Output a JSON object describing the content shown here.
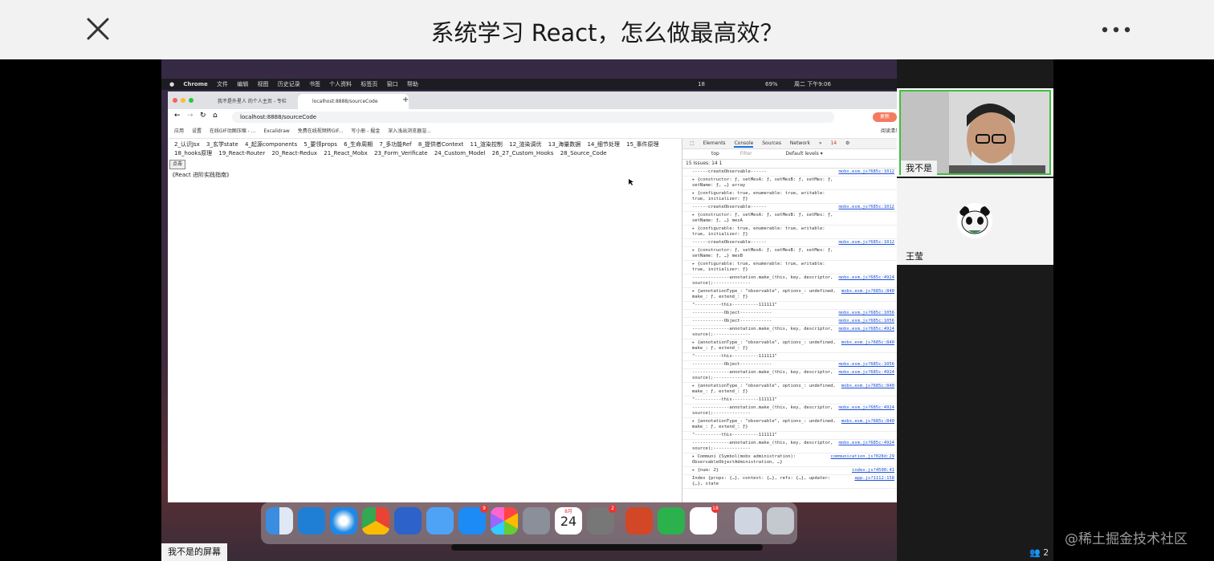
{
  "header": {
    "title": "系统学习 React，怎么做最高效？"
  },
  "mac_menubar": {
    "items": [
      "Chrome",
      "文件",
      "编辑",
      "视图",
      "历史记录",
      "书签",
      "个人资料",
      "标签页",
      "窗口",
      "帮助"
    ],
    "status": "周二 下午9:06",
    "battery": "69%",
    "badge": "18"
  },
  "browser": {
    "tabs": [
      "我不是外星人 的个人主页 - 专栏",
      "localhost:8888/sourceCode"
    ],
    "url": "localhost:8888/sourceCode",
    "update_label": "更新",
    "bookmarks": [
      "应用",
      "设置",
      "在线GIF动图压缩 - ...",
      "Excalidraw",
      "免费在线视频转GIF...",
      "写小册 - 掘金",
      "深入浅出浏览器渲..."
    ],
    "reading_list": "阅读清单"
  },
  "page": {
    "nav_row1": [
      "2_认识Jsx",
      "3_玄学state",
      "4_起源components",
      "5_要领props",
      "6_生命周期",
      "7_多功能Ref",
      "8_提供者Context",
      "11_渲染控制",
      "12_渲染调优",
      "13_海量数据",
      "14_细节处理",
      "15_事件原理"
    ],
    "nav_row2": [
      "18_hooks原理",
      "19_React-Router",
      "20_React-Redux",
      "21_React_Mobx",
      "23_Form_Verificate",
      "24_Custom_Model",
      "26_27_Custom_Hooks",
      "28_Source_Code"
    ],
    "button_label": "点击",
    "book_title": "《React 进阶实践指南》"
  },
  "devtools": {
    "tabs": [
      "Elements",
      "Console",
      "Sources",
      "Network",
      "»"
    ],
    "errors": "14",
    "context": "top",
    "filter_placeholder": "Filter",
    "levels": "Default levels ▾",
    "issues": "15 Issues:  14  1",
    "logs": [
      {
        "text": "------createObservable------",
        "src": "mobx.esm.js?685c:1012"
      },
      {
        "text": "▸ {constructor: ƒ, setMesA: ƒ, setMesB: ƒ, setMes: ƒ, setName: ƒ, …} array",
        "src": ""
      },
      {
        "text": "▸ {configurable: true, enumerable: true, writable: true, initializer: ƒ}",
        "src": ""
      },
      {
        "text": "------createObservable------",
        "src": "mobx.esm.js?685c:1012"
      },
      {
        "text": "▸ {constructor: ƒ, setMesA: ƒ, setMesB: ƒ, setMes: ƒ, setName: ƒ, …} mesA",
        "src": ""
      },
      {
        "text": "▸ {configurable: true, enumerable: true, writable: true, initializer: ƒ}",
        "src": ""
      },
      {
        "text": "------createObservable------",
        "src": "mobx.esm.js?685c:1012"
      },
      {
        "text": "▸ {constructor: ƒ, setMesA: ƒ, setMesB: ƒ, setMes: ƒ, setName: ƒ, …} mesB",
        "src": ""
      },
      {
        "text": "▸ {configurable: true, enumerable: true, writable: true, initializer: ƒ}",
        "src": ""
      },
      {
        "text": "--------------annotation.make_(this, key, descriptor, source);--------------",
        "src": "mobx.esm.js?685c:4924"
      },
      {
        "text": "▸ {annotationType_: \"observable\", options_: undefined, make_: ƒ, extend_: ƒ}",
        "src": "mobx.esm.js?685c:840"
      },
      {
        "text": "\"----------this----------111111\"",
        "src": ""
      },
      {
        "text": "------------Object------------",
        "src": "mobx.esm.js?685c:1056"
      },
      {
        "text": "------------Object------------",
        "src": "mobx.esm.js?685c:1056"
      },
      {
        "text": "--------------annotation.make_(this, key, descriptor, source);--------------",
        "src": "mobx.esm.js?685c:4924"
      },
      {
        "text": "▸ {annotationType_: \"observable\", options_: undefined, make_: ƒ, extend_: ƒ}",
        "src": "mobx.esm.js?685c:840"
      },
      {
        "text": "\"----------this----------111111\"",
        "src": ""
      },
      {
        "text": "------------Object------------",
        "src": "mobx.esm.js?685c:1056"
      },
      {
        "text": "--------------annotation.make_(this, key, descriptor, source);--------------",
        "src": "mobx.esm.js?685c:4924"
      },
      {
        "text": "▸ {annotationType_: \"observable\", options_: undefined, make_: ƒ, extend_: ƒ}",
        "src": "mobx.esm.js?685c:840"
      },
      {
        "text": "\"----------this----------111111\"",
        "src": ""
      },
      {
        "text": "--------------annotation.make_(this, key, descriptor, source);--------------",
        "src": "mobx.esm.js?685c:4924"
      },
      {
        "text": "▸ {annotationType_: \"observable\", options_: undefined, make_: ƒ, extend_: ƒ}",
        "src": "mobx.esm.js?685c:840"
      },
      {
        "text": "\"----------this----------111111\"",
        "src": ""
      },
      {
        "text": "--------------annotation.make_(this, key, descriptor, source);--------------",
        "src": "mobx.esm.js?685c:4924"
      },
      {
        "text": "▸ Communi {Symbol(mobx administration): ObservableObjectAdministration, …}",
        "src": "communication.js?028d:29"
      },
      {
        "text": "▸ {num: 2}",
        "src": "index.js?4500:41"
      },
      {
        "text": "Index {props: {…}, context: {…}, refs: {…}, updater: {…}, state",
        "src": "app.js?1112:158"
      }
    ]
  },
  "dock": {
    "calendar_month": "8月",
    "calendar_day": "24",
    "badges": {
      "appstore": "9",
      "settings": "2",
      "feishu": "18"
    }
  },
  "share_label": "我不是的屏幕",
  "participants": {
    "p1_name": "我不是",
    "p2_name": "王莹",
    "count": "2"
  },
  "watermark": "@稀土掘金技术社区"
}
